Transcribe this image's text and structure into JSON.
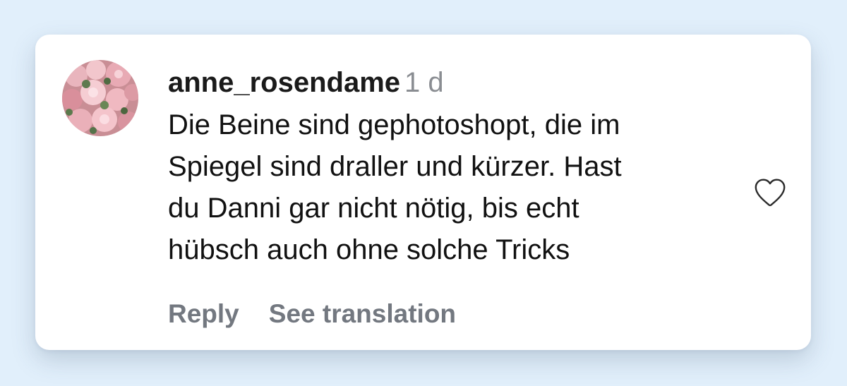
{
  "comment": {
    "username": "anne_rosendame",
    "time": "1 d",
    "text_lines": [
      "Die Beine sind gephotoshopt, die im",
      "Spiegel sind draller und kürzer. Hast",
      "du Danni gar nicht nötig, bis echt",
      "hübsch auch ohne solche Tricks"
    ],
    "avatar_icon": "rose-bouquet-avatar",
    "like_icon": "heart-outline-icon"
  },
  "actions": {
    "reply_label": "Reply",
    "translate_label": "See translation"
  },
  "colors": {
    "background": "#e1effb",
    "card": "#ffffff",
    "username": "#1a1a1a",
    "time": "#8a8d92",
    "text": "#111111",
    "action": "#737880",
    "heart_outline": "#2b2b2b"
  }
}
